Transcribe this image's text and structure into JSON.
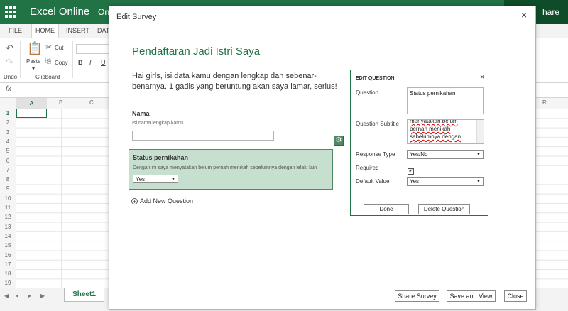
{
  "app": {
    "name": "Excel Online",
    "doc_fragment": "On",
    "share_label": "hare"
  },
  "ribbon": {
    "tabs": [
      "FILE",
      "HOME",
      "INSERT",
      "DAT"
    ],
    "undo_label": "Undo",
    "paste_label": "Paste",
    "cut_label": "Cut",
    "copy_label": "Copy",
    "clipboard_label": "Clipboard",
    "bold": "B",
    "italic": "I",
    "underline": "U"
  },
  "formula_bar": {
    "fx_label": "fx"
  },
  "grid": {
    "columns": [
      "A",
      "B",
      "C",
      "R"
    ],
    "rows": [
      "1",
      "2",
      "3",
      "4",
      "5",
      "6",
      "7",
      "8",
      "9",
      "10",
      "11",
      "12",
      "13",
      "14",
      "15",
      "16",
      "17",
      "18",
      "19"
    ]
  },
  "sheets": {
    "active": "Sheet1"
  },
  "dialog": {
    "title": "Edit Survey",
    "close_icon": "×",
    "survey_title": "Pendaftaran Jadi Istri Saya",
    "survey_description": "Hai girls, isi data kamu dengan lengkap dan sebenar-benarnya. 1 gadis yang beruntung akan saya lamar, serius!",
    "question1": {
      "label": "Nama",
      "subtitle": "Isi nama lengkap kamu"
    },
    "question2": {
      "label": "Status pernikahan",
      "subtitle": "Dengan ini saya menyatakan belum pernah menikah sebelumnya dengan lelaki lain",
      "selected": "Yes"
    },
    "add_question_label": "Add New Question",
    "buttons": {
      "share": "Share Survey",
      "save_view": "Save and View",
      "close": "Close"
    }
  },
  "edit_panel": {
    "title": "EDIT QUESTION",
    "close_icon": "×",
    "question_label": "Question",
    "question_value": "Status pernikahan",
    "subtitle_label": "Question Subtitle",
    "subtitle_value": "menyatakan belum pernah menikah sebelumnya dengan lelaki lain",
    "response_type_label": "Response Type",
    "response_type_value": "Yes/No",
    "required_label": "Required",
    "required_checked": true,
    "default_value_label": "Default Value",
    "default_value_value": "Yes",
    "done_label": "Done",
    "delete_label": "Delete Question"
  }
}
